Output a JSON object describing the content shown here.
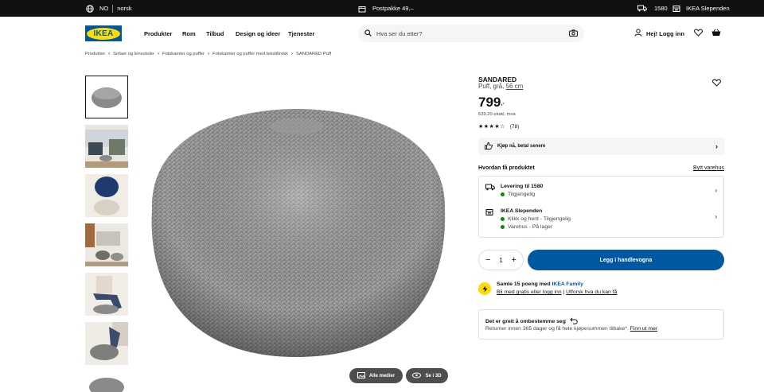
{
  "topbar": {
    "country_code": "NO",
    "language": "norsk",
    "shipping": "Postpakke 49,–",
    "postcode": "1580",
    "store": "IKEA Slependen"
  },
  "header": {
    "logo_text": "IKEA",
    "nav": [
      "Produkter",
      "Rom",
      "Tilbud",
      "Design og ideer",
      "Tjenester"
    ],
    "search_placeholder": "Hva ser du etter?",
    "login": "Hej! Logg inn"
  },
  "breadcrumb": [
    "Produkter",
    "Sofaer og lenestoler",
    "Fotskamler og puffer",
    "Fotskamler og puffer med tekstiltrekk",
    "SANDARED Puff"
  ],
  "product": {
    "name": "SANDARED",
    "desc_prefix": "Puff, grå,",
    "size": "56 cm",
    "price": "799",
    "price_suffix": ",-",
    "price_ex_vat": "639,20 ekskl. mva",
    "stars": "★★★★☆",
    "rating_count": "(78)"
  },
  "paynow": "Kjøp nå, betal senere",
  "delivery": {
    "heading": "Hvordan få produktet",
    "change_store": "Bytt varehus",
    "home": {
      "title": "Levering til 1580",
      "status": "Tilgjengelig"
    },
    "store": {
      "title": "IKEA Slependen",
      "line1": "Klikk og hent - Tilgjengelig",
      "line2": "Varehus - På lager"
    }
  },
  "cart": {
    "quantity": "1",
    "minus": "−",
    "plus": "+",
    "add_label": "Legg i handlevogna"
  },
  "family": {
    "line1_prefix": "Samle 15 poeng med",
    "line1_brand": "IKEA Family",
    "join": "Bli med gratis eller logg inn",
    "divider": "|",
    "explore": "Utforsk hva du kan få"
  },
  "returns": {
    "title": "Det er greit å ombestemme seg",
    "text": "Returner innen 365 dager og få hele kjøpesummen tilbake*.",
    "link": "Finn ut mer"
  },
  "media": {
    "all_media": "Alle medier",
    "view_3d": "Se i 3D"
  },
  "colors": {
    "brand_blue": "#0058a3",
    "brand_yellow": "#ffdb00",
    "available_green": "#0a8a00"
  }
}
